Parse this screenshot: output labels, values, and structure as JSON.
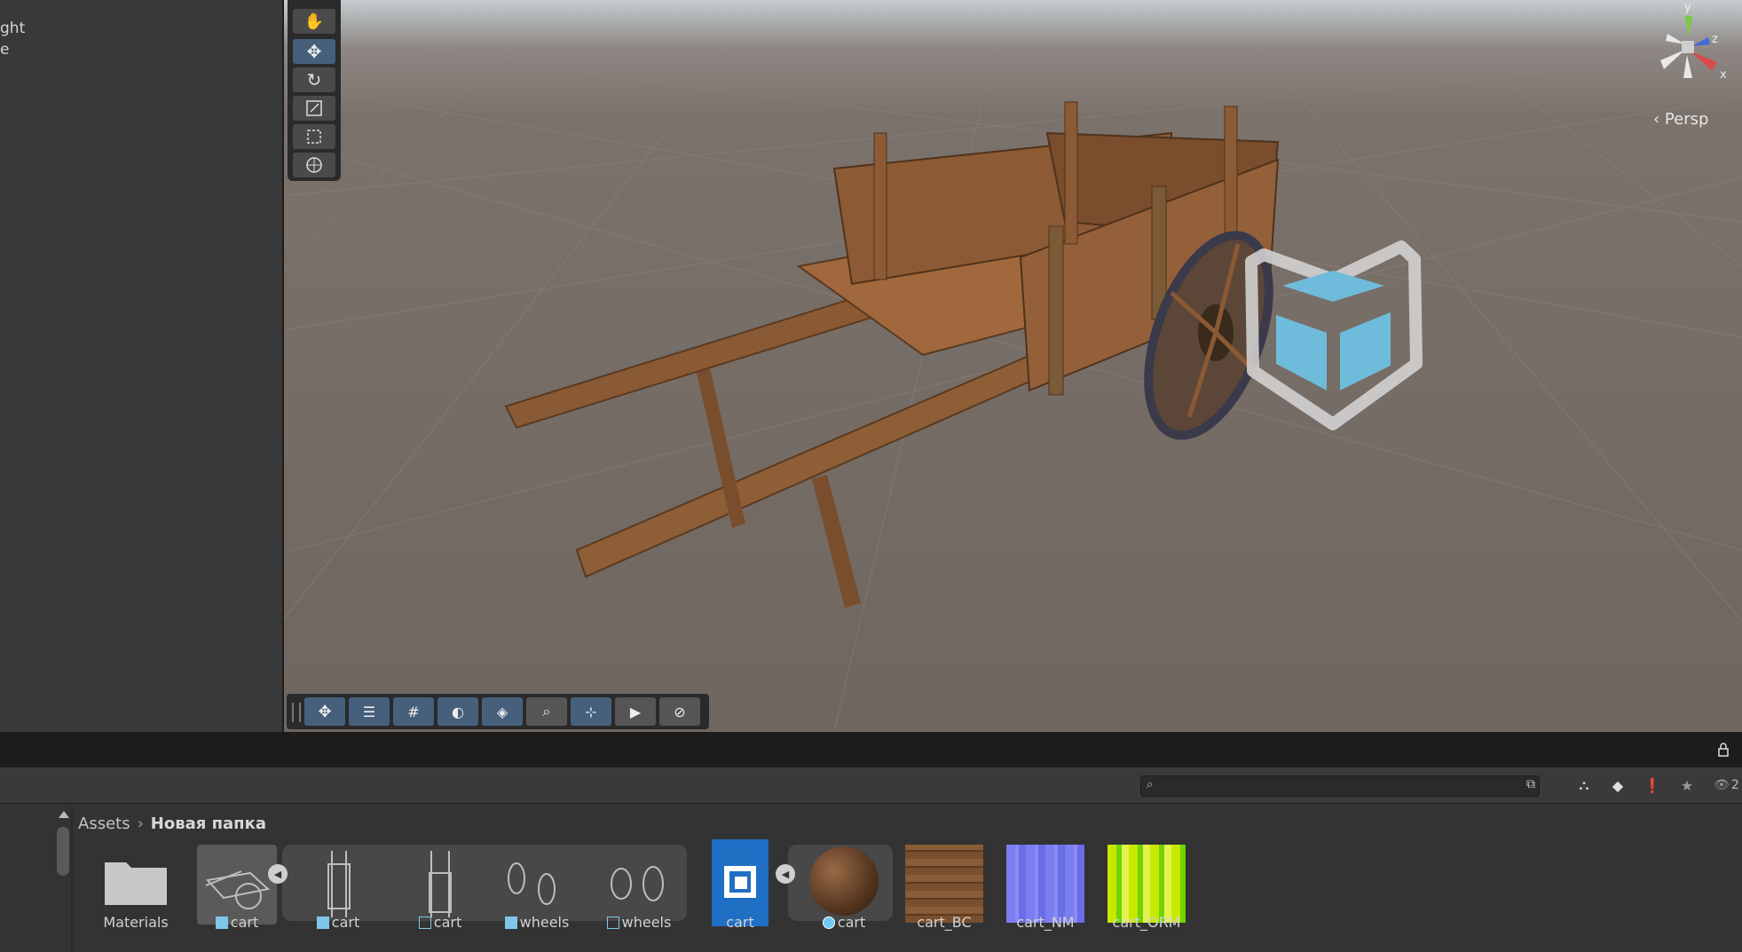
{
  "hierarchy": {
    "items": [
      "ght",
      "e"
    ]
  },
  "scene": {
    "camera_mode": "Persp",
    "gizmo_axes": [
      "y",
      "z",
      "x"
    ],
    "tools": [
      {
        "name": "hand-tool",
        "icon": "hand-icon",
        "active": false
      },
      {
        "name": "move-tool",
        "icon": "move-icon",
        "active": true
      },
      {
        "name": "rotate-tool",
        "icon": "rotate-icon",
        "active": false
      },
      {
        "name": "scale-tool",
        "icon": "scale-icon",
        "active": false
      },
      {
        "name": "rect-tool",
        "icon": "rect-transform-icon",
        "active": false
      },
      {
        "name": "transform-tool",
        "icon": "transform-icon",
        "active": false
      }
    ],
    "overlay_buttons": [
      {
        "icon": "move-icon",
        "on": true
      },
      {
        "icon": "toolbar-settings-icon",
        "on": true
      },
      {
        "icon": "grid-snap-icon",
        "on": true
      },
      {
        "icon": "shading-icon",
        "on": true
      },
      {
        "icon": "layers-icon",
        "on": true
      },
      {
        "icon": "search-icon",
        "on": false
      },
      {
        "icon": "pivot-icon",
        "on": true
      },
      {
        "icon": "camera-icon",
        "on": false
      },
      {
        "icon": "compass-icon",
        "on": false
      }
    ]
  },
  "project": {
    "breadcrumb": {
      "root": "Assets",
      "current": "Новая папка"
    },
    "search": {
      "placeholder": ""
    },
    "hidden_count": "2",
    "assets": [
      {
        "label": "Materials",
        "kind": "folder"
      },
      {
        "label": "cart",
        "kind": "model"
      },
      {
        "label": "cart",
        "kind": "model"
      },
      {
        "label": "cart",
        "kind": "mesh"
      },
      {
        "label": "wheels",
        "kind": "model"
      },
      {
        "label": "wheels",
        "kind": "mesh"
      },
      {
        "label": "cart",
        "kind": "prefab"
      },
      {
        "label": "cart",
        "kind": "material"
      },
      {
        "label": "cart_BC",
        "kind": "texture"
      },
      {
        "label": "cart_NM",
        "kind": "texture"
      },
      {
        "label": "cart_ORM",
        "kind": "texture"
      }
    ]
  },
  "colors": {
    "accent": "#46607c",
    "prefab_blue": "#1f6fc4",
    "cube_cyan": "#6ec9f0"
  }
}
